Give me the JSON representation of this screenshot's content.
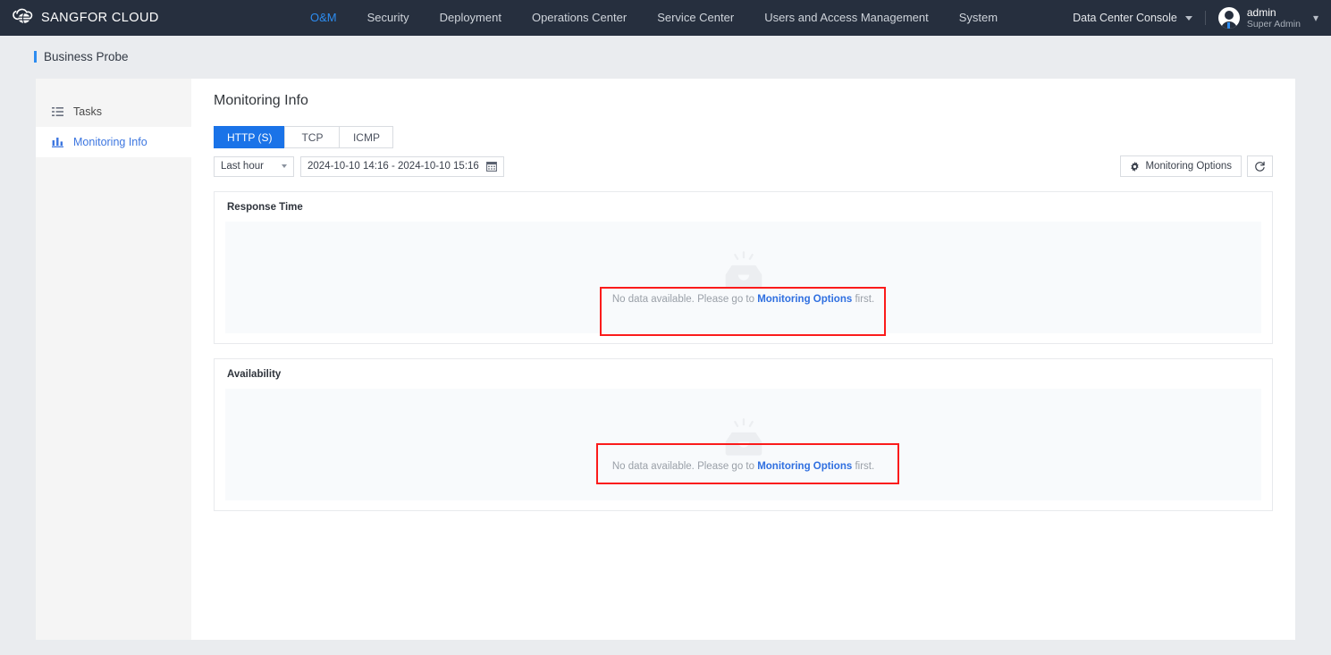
{
  "header": {
    "brand": "SANGFOR CLOUD",
    "logo_icon": "sangfor-cloud-logo",
    "nav": [
      {
        "label": "O&M",
        "active": true
      },
      {
        "label": "Security",
        "active": false
      },
      {
        "label": "Deployment",
        "active": false
      },
      {
        "label": "Operations Center",
        "active": false
      },
      {
        "label": "Service Center",
        "active": false
      },
      {
        "label": "Users and Access Management",
        "active": false
      },
      {
        "label": "System",
        "active": false
      }
    ],
    "console_selector": "Data Center Console",
    "user": {
      "name": "admin",
      "role": "Super Admin"
    }
  },
  "breadcrumb": {
    "text": "Business Probe"
  },
  "sidebar": {
    "items": [
      {
        "label": "Tasks",
        "icon": "list-icon",
        "active": false
      },
      {
        "label": "Monitoring Info",
        "icon": "bar-chart-icon",
        "active": true
      }
    ]
  },
  "main": {
    "title": "Monitoring Info",
    "tabs": [
      {
        "label": "HTTP (S)",
        "active": true
      },
      {
        "label": "TCP",
        "active": false
      },
      {
        "label": "ICMP",
        "active": false
      }
    ],
    "toolbar": {
      "range_preset": "Last hour",
      "date_range": "2024-10-10 14:16 - 2024-10-10 15:16",
      "monitoring_options_label": "Monitoring Options",
      "refresh_label": "",
      "refresh_icon": "refresh-icon",
      "gear_icon": "gear-icon",
      "calendar_icon": "calendar-icon"
    },
    "cards": [
      {
        "title": "Response Time",
        "empty": {
          "icon": "empty-box-icon",
          "text_before": "No data available. Please go to ",
          "link": "Monitoring Options",
          "text_after": " first."
        }
      },
      {
        "title": "Availability",
        "empty": {
          "icon": "empty-box-icon",
          "text_before": "No data available. Please go to ",
          "link": "Monitoring Options",
          "text_after": " first."
        }
      }
    ]
  },
  "annotations": {
    "color": "#fb1b1b",
    "boxes": [
      "response-time-empty-message",
      "availability-empty-message"
    ]
  },
  "colors": {
    "header_bg": "#262f3e",
    "accent": "#2d8cf0",
    "tab_active": "#1a73e8",
    "page_bg": "#eaecef",
    "sidebar_bg": "#f5f5f5",
    "link": "#2f6fe0"
  }
}
